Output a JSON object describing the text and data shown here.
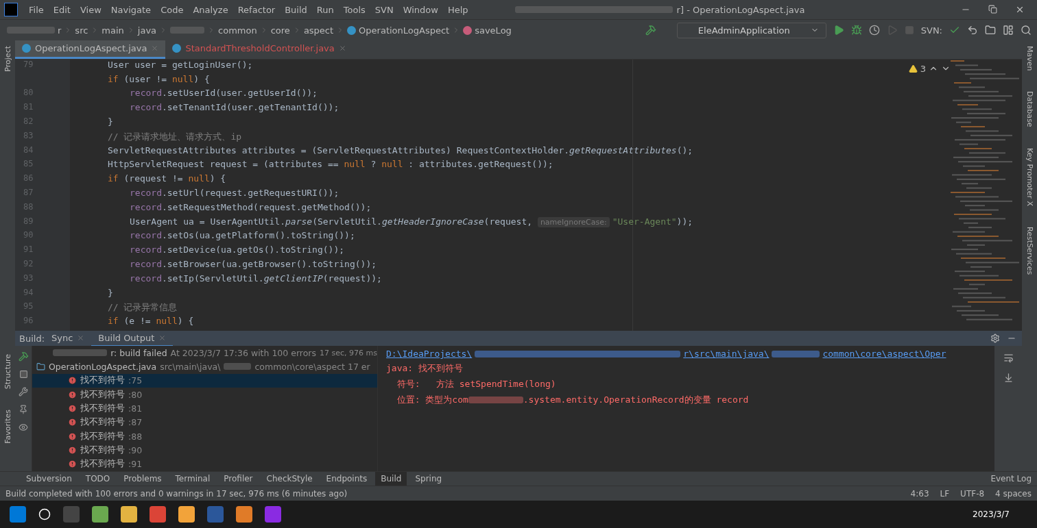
{
  "window": {
    "title": "r] - OperationLogAspect.java"
  },
  "menu": [
    "File",
    "Edit",
    "View",
    "Navigate",
    "Code",
    "Analyze",
    "Refactor",
    "Build",
    "Run",
    "Tools",
    "SVN",
    "Window",
    "Help"
  ],
  "breadcrumb": [
    "r",
    "src",
    "main",
    "java",
    "common",
    "core",
    "aspect",
    "OperationLogAspect",
    "saveLog"
  ],
  "run_config": "EleAdminApplication",
  "svn_label": "SVN:",
  "left_stripe": [
    "Project"
  ],
  "right_stripe": [
    "Maven",
    "Database",
    "Key Promoter X",
    "RestServices"
  ],
  "editor_tabs": [
    {
      "label": "OperationLogAspect.java",
      "selected": true,
      "error": false
    },
    {
      "label": "StandardThresholdController.java",
      "selected": false,
      "error": true
    }
  ],
  "editor": {
    "warnings": "3",
    "lines": [
      {
        "number": "79",
        "indented": false,
        "tokens": [
          {
            "kind": "plain",
            "text": "User user = getLoginUser();"
          }
        ]
      },
      {
        "indented": false,
        "tokens": [
          {
            "kind": "kw",
            "text": "if "
          },
          {
            "kind": "plain",
            "text": "(user != "
          },
          {
            "kind": "kw",
            "text": "null"
          },
          {
            "kind": "plain",
            "text": ") {"
          }
        ]
      },
      {
        "number": "80",
        "indented": true,
        "tokens": [
          {
            "kind": "field",
            "text": "record"
          },
          {
            "kind": "plain",
            "text": ".setUserId(user.getUserId());"
          }
        ]
      },
      {
        "number": "81",
        "indented": true,
        "tokens": [
          {
            "kind": "field",
            "text": "record"
          },
          {
            "kind": "plain",
            "text": ".setTenantId(user.getTenantId());"
          }
        ]
      },
      {
        "number": "82",
        "indented": false,
        "tokens": [
          {
            "kind": "plain",
            "text": "}"
          }
        ]
      },
      {
        "number": "83",
        "indented": false,
        "tokens": [
          {
            "kind": "comment",
            "text": "// 记录请求地址、请求方式、ip"
          }
        ]
      },
      {
        "number": "84",
        "indented": false,
        "tokens": [
          {
            "kind": "plain",
            "text": "ServletRequestAttributes attributes = (ServletRequestAttributes) RequestContextHolder."
          },
          {
            "kind": "static",
            "text": "getRequestAttributes"
          },
          {
            "kind": "plain",
            "text": "();"
          }
        ]
      },
      {
        "number": "85",
        "indented": false,
        "tokens": [
          {
            "kind": "plain",
            "text": "HttpServletRequest request = (attributes == "
          },
          {
            "kind": "kw",
            "text": "null"
          },
          {
            "kind": "plain",
            "text": " ? "
          },
          {
            "kind": "kw",
            "text": "null"
          },
          {
            "kind": "plain",
            "text": " : attributes.getRequest());"
          }
        ]
      },
      {
        "number": "86",
        "indented": false,
        "tokens": [
          {
            "kind": "kw",
            "text": "if "
          },
          {
            "kind": "plain",
            "text": "(request != "
          },
          {
            "kind": "kw",
            "text": "null"
          },
          {
            "kind": "plain",
            "text": ") {"
          }
        ]
      },
      {
        "number": "87",
        "indented": true,
        "tokens": [
          {
            "kind": "field",
            "text": "record"
          },
          {
            "kind": "plain",
            "text": ".setUrl(request.getRequestURI());"
          }
        ]
      },
      {
        "number": "88",
        "indented": true,
        "tokens": [
          {
            "kind": "field",
            "text": "record"
          },
          {
            "kind": "plain",
            "text": ".setRequestMethod(request.getMethod());"
          }
        ]
      },
      {
        "number": "89",
        "indented": true,
        "tokens": [
          {
            "kind": "plain",
            "text": "UserAgent ua = UserAgentUtil."
          },
          {
            "kind": "static",
            "text": "parse"
          },
          {
            "kind": "plain",
            "text": "(ServletUtil."
          },
          {
            "kind": "static",
            "text": "getHeaderIgnoreCase"
          },
          {
            "kind": "plain",
            "text": "(request, "
          },
          {
            "kind": "hint",
            "text": "nameIgnoreCase:"
          },
          {
            "kind": "string",
            "text": "\"User-Agent\""
          },
          {
            "kind": "plain",
            "text": "));"
          }
        ]
      },
      {
        "number": "90",
        "indented": true,
        "tokens": [
          {
            "kind": "field",
            "text": "record"
          },
          {
            "kind": "plain",
            "text": ".setOs(ua.getPlatform().toString());"
          }
        ]
      },
      {
        "number": "91",
        "indented": true,
        "tokens": [
          {
            "kind": "field",
            "text": "record"
          },
          {
            "kind": "plain",
            "text": ".setDevice(ua.getOs().toString());"
          }
        ]
      },
      {
        "number": "92",
        "indented": true,
        "tokens": [
          {
            "kind": "field",
            "text": "record"
          },
          {
            "kind": "plain",
            "text": ".setBrowser(ua.getBrowser().toString());"
          }
        ]
      },
      {
        "number": "93",
        "indented": true,
        "tokens": [
          {
            "kind": "field",
            "text": "record"
          },
          {
            "kind": "plain",
            "text": ".setIp(ServletUtil."
          },
          {
            "kind": "static",
            "text": "getClientIP"
          },
          {
            "kind": "plain",
            "text": "(request));"
          }
        ]
      },
      {
        "number": "94",
        "indented": false,
        "tokens": [
          {
            "kind": "plain",
            "text": "}"
          }
        ]
      },
      {
        "number": "95",
        "indented": false,
        "tokens": [
          {
            "kind": "comment",
            "text": "// 记录异常信息"
          }
        ]
      },
      {
        "number": "96",
        "indented": false,
        "tokens": [
          {
            "kind": "kw",
            "text": "if "
          },
          {
            "kind": "plain",
            "text": "(e != "
          },
          {
            "kind": "kw",
            "text": "null"
          },
          {
            "kind": "plain",
            "text": ") {"
          }
        ]
      }
    ]
  },
  "build": {
    "label": "Build:",
    "tabs": [
      {
        "label": "Sync",
        "selected": false
      },
      {
        "label": "Build Output",
        "selected": true
      }
    ],
    "side_stripe": [
      "Structure",
      "Favorites"
    ],
    "tree": {
      "title": "r: build failed",
      "detail": "At 2023/3/7 17:36 with 100 errors",
      "time": "17 sec, 976 ms",
      "children": [
        {
          "name": "OperationLogAspect.java",
          "path": "src\\main\\java\\",
          "path_rest": "common\\core\\aspect 17 er",
          "children": [
            {
              "label": "找不到符号",
              "line": ":75",
              "selected": true
            },
            {
              "label": "找不到符号",
              "line": ":80",
              "selected": false
            },
            {
              "label": "找不到符号",
              "line": ":81",
              "selected": false
            },
            {
              "label": "找不到符号",
              "line": ":87",
              "selected": false
            },
            {
              "label": "找不到符号",
              "line": ":88",
              "selected": false
            },
            {
              "label": "找不到符号",
              "line": ":90",
              "selected": false
            },
            {
              "label": "找不到符号",
              "line": ":91",
              "selected": false
            }
          ]
        }
      ]
    },
    "output": {
      "link_parts": [
        "D:\\IdeaProjects\\",
        "r\\src\\main\\java\\",
        "common\\core\\aspect\\Oper"
      ],
      "lines": [
        "java: 找不到符号",
        "  符号:   方法 setSpendTime(long)"
      ],
      "location_start": "  位置: 类型为com",
      "location_end": ".system.entity.OperationRecord的变量 record"
    }
  },
  "tool_tabs": [
    {
      "label": "Subversion",
      "selected": false
    },
    {
      "label": "TODO",
      "selected": false
    },
    {
      "label": "Problems",
      "selected": false
    },
    {
      "label": "Terminal",
      "selected": false
    },
    {
      "label": "Profiler",
      "selected": false
    },
    {
      "label": "CheckStyle",
      "selected": false
    },
    {
      "label": "Endpoints",
      "selected": false
    },
    {
      "label": "Build",
      "selected": true
    },
    {
      "label": "Spring",
      "selected": false
    }
  ],
  "event_log": "Event Log",
  "status_bar": {
    "message": "Build completed with 100 errors and 0 warnings in 17 sec, 976 ms (6 minutes ago)",
    "items": [
      "4:63",
      "LF",
      "UTF-8",
      "4 spaces"
    ]
  },
  "taskbar": {
    "date": "2023/3/7"
  }
}
